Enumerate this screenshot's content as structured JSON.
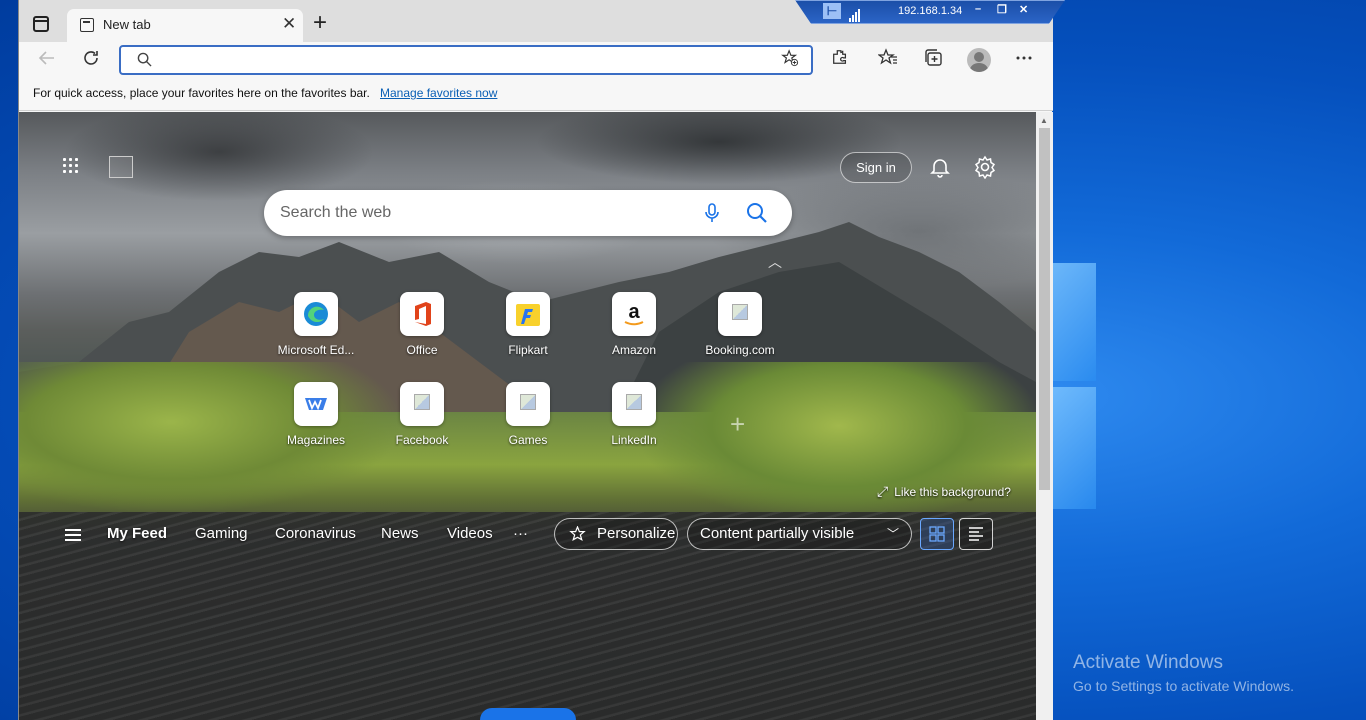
{
  "browser": {
    "tab": {
      "title": "New tab",
      "close": "✕"
    },
    "new_tab": "+",
    "address_bar": {
      "value": "",
      "placeholder": ""
    },
    "favorites_bar": {
      "hint": "For quick access, place your favorites here on the favorites bar.",
      "manage_link": "Manage favorites now"
    }
  },
  "remote_session": {
    "host": "192.168.1.34"
  },
  "new_tab_page": {
    "sign_in": "Sign in",
    "search": {
      "placeholder": "Search the web"
    },
    "quick_links": [
      {
        "label": "Microsoft Ed...",
        "icon": "edge-icon"
      },
      {
        "label": "Office",
        "icon": "office-icon"
      },
      {
        "label": "Flipkart",
        "icon": "flipkart-icon"
      },
      {
        "label": "Amazon",
        "icon": "amazon-icon"
      },
      {
        "label": "Booking.com",
        "icon": "broken-image-icon"
      },
      {
        "label": "Magazines",
        "icon": "magazines-icon"
      },
      {
        "label": "Facebook",
        "icon": "broken-image-icon"
      },
      {
        "label": "Games",
        "icon": "broken-image-icon"
      },
      {
        "label": "LinkedIn",
        "icon": "broken-image-icon"
      }
    ],
    "add_tile": "+",
    "like_background": "Like this background?",
    "feed": {
      "tabs": [
        "My Feed",
        "Gaming",
        "Coronavirus",
        "News",
        "Videos"
      ],
      "more": "···",
      "personalize": "Personalize",
      "content_visibility": "Content partially visible"
    }
  },
  "desktop": {
    "activate_title": "Activate Windows",
    "activate_subtitle": "Go to Settings to activate Windows."
  },
  "colors": {
    "accent": "#3a6dc4",
    "link": "#0a5fb5",
    "desktop_blue": "#0550bd"
  }
}
